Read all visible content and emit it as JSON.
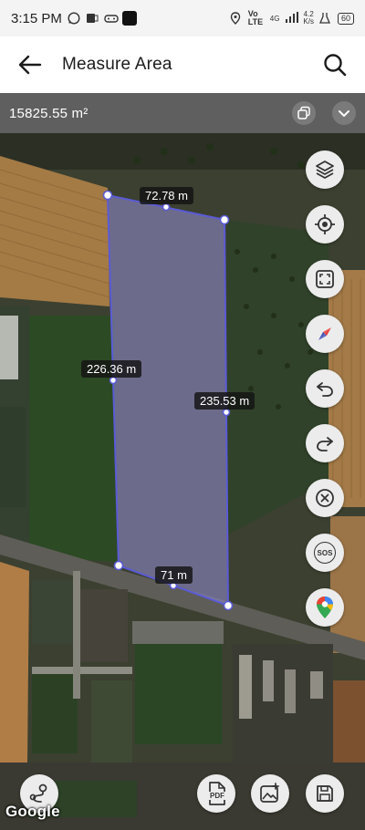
{
  "status_bar": {
    "time": "3:15 PM",
    "network_label": "Vo LTE",
    "signal_label": "4G",
    "speed_value": "4.2",
    "speed_unit": "K/s",
    "battery": "60"
  },
  "app_bar": {
    "title": "Measure Area",
    "back_icon": "arrow-left-icon",
    "search_icon": "search-icon"
  },
  "area_bar": {
    "area": "15825.55 m²",
    "copy_icon": "copy-icon",
    "expand_icon": "chevron-down-icon"
  },
  "map": {
    "labels": {
      "top": "72.78 m",
      "left": "226.36 m",
      "right": "235.53 m",
      "bottom": "71 m"
    },
    "attribution": "Google",
    "polygon_color": "#5b5bd6",
    "pdf_label": "PDF"
  },
  "rail": [
    {
      "name": "layers-button",
      "icon": "layers-icon"
    },
    {
      "name": "my-location-button",
      "icon": "crosshair-icon"
    },
    {
      "name": "fit-bounds-button",
      "icon": "fullscreen-icon"
    },
    {
      "name": "compass-button",
      "icon": "compass-icon"
    },
    {
      "name": "undo-button",
      "icon": "undo-icon"
    },
    {
      "name": "redo-button",
      "icon": "redo-icon"
    },
    {
      "name": "clear-button",
      "icon": "close-circle-icon"
    },
    {
      "name": "sos-button",
      "icon": "sos-icon",
      "label": "SOS"
    },
    {
      "name": "google-maps-button",
      "icon": "google-maps-pin-icon"
    }
  ]
}
